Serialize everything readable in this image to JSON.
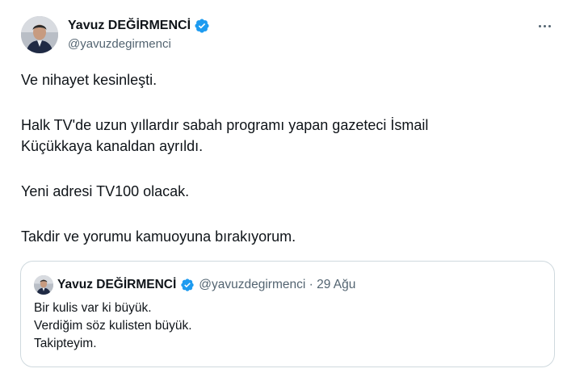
{
  "author": {
    "name": "Yavuz DEĞİRMENCİ",
    "handle": "@yavuzdegirmenci",
    "verified_color": "#1d9bf0"
  },
  "icons": {
    "more": "more-horizontal-icon",
    "verified": "verified-badge-icon",
    "avatar": "profile-photo"
  },
  "tweet": {
    "paragraphs": [
      "Ve nihayet kesinleşti.",
      "Halk TV'de uzun yıllardır sabah programı yapan gazeteci İsmail Küçükkaya kanaldan ayrıldı.",
      "Yeni adresi TV100 olacak.",
      "Takdir ve yorumu kamuoyuna bırakıyorum."
    ]
  },
  "quoted_tweet": {
    "name": "Yavuz DEĞİRMENCİ",
    "meta": "@yavuzdegirmenci · 29 Ağu",
    "lines": [
      "Bir kulis var ki büyük.",
      "Verdiğim söz kulisten büyük.",
      "Takipteyim."
    ]
  }
}
